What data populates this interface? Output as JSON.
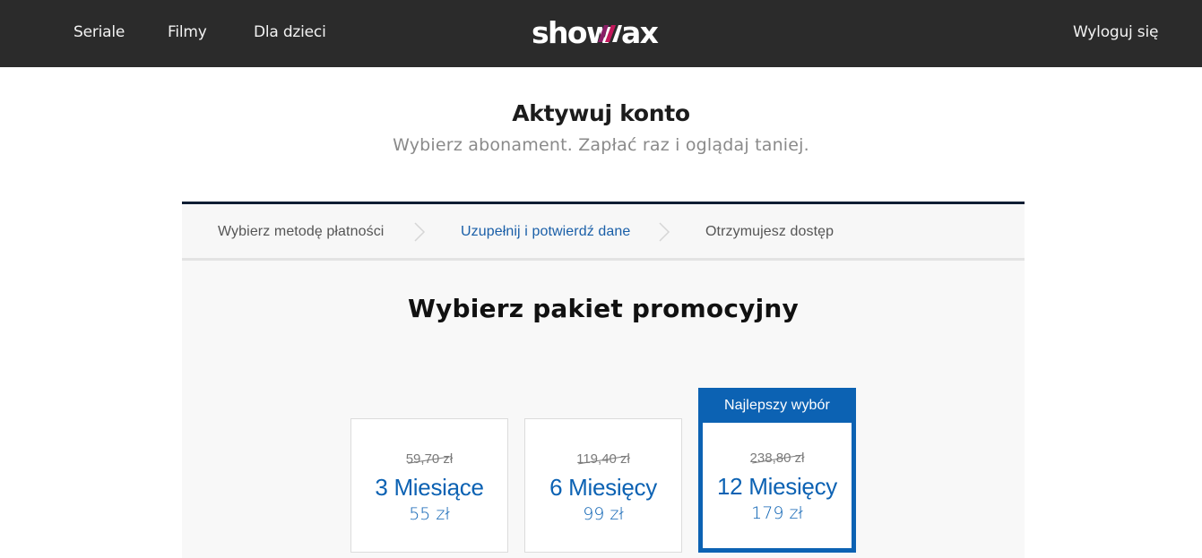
{
  "header": {
    "nav": [
      "Seriale",
      "Filmy",
      "Dla dzieci"
    ],
    "logo": "showmax",
    "logout_label": "Wyloguj się"
  },
  "page": {
    "title": "Aktywuj konto",
    "subtitle": "Wybierz abonament. Zapłać raz i oglądaj taniej."
  },
  "steps": [
    {
      "label": "Wybierz metodę płatności"
    },
    {
      "label": "Uzupełnij i potwierdź dane"
    },
    {
      "label": "Otrzymujesz dostęp"
    }
  ],
  "section_title": "Wybierz pakiet promocyjny",
  "plans": [
    {
      "old_price": "59,70 zł",
      "name": "3 Miesiące",
      "price": "55 zł"
    },
    {
      "old_price": "119,40 zł",
      "name": "6 Miesięcy",
      "price": "99 zł"
    },
    {
      "badge": "Najlepszy wybór",
      "old_price": "238,80 zł",
      "name": "12 Miesięcy",
      "price": "179 zł"
    }
  ],
  "colors": {
    "topbar": "#2b2b2b",
    "accent": "#0c62b3",
    "active_step": "#1a5fa8",
    "logo_slash": "#c2185b"
  },
  "icons": [
    "chevron-right-icon",
    "logo-slash-icon"
  ]
}
